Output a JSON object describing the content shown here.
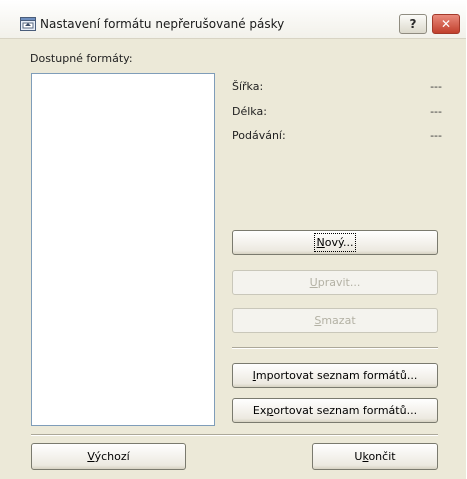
{
  "window": {
    "title": "Nastavení formátu nepřerušované pásky",
    "help_label": "?",
    "close_label": "✕"
  },
  "formats": {
    "label": "Dostupné formáty:",
    "items": []
  },
  "properties": [
    {
      "label": "Šířka:",
      "value": "---"
    },
    {
      "label": "Délka:",
      "value": "---"
    },
    {
      "label": "Podávání:",
      "value": "---"
    }
  ],
  "buttons": {
    "new": {
      "pre": "",
      "key": "N",
      "post": "ový...",
      "enabled": true
    },
    "edit": {
      "pre": "",
      "key": "U",
      "post": "pravit...",
      "enabled": false
    },
    "delete": {
      "pre": "",
      "key": "S",
      "post": "mazat",
      "enabled": false
    },
    "import": {
      "pre": "",
      "key": "I",
      "post": "mportovat seznam formátů...",
      "enabled": true
    },
    "export": {
      "pre": "Ex",
      "key": "p",
      "post": "ortovat seznam formátů...",
      "enabled": true
    },
    "default": {
      "pre": "",
      "key": "V",
      "post": "ýchozí",
      "enabled": true
    },
    "close": {
      "pre": "U",
      "key": "k",
      "post": "ončit",
      "enabled": true
    }
  }
}
